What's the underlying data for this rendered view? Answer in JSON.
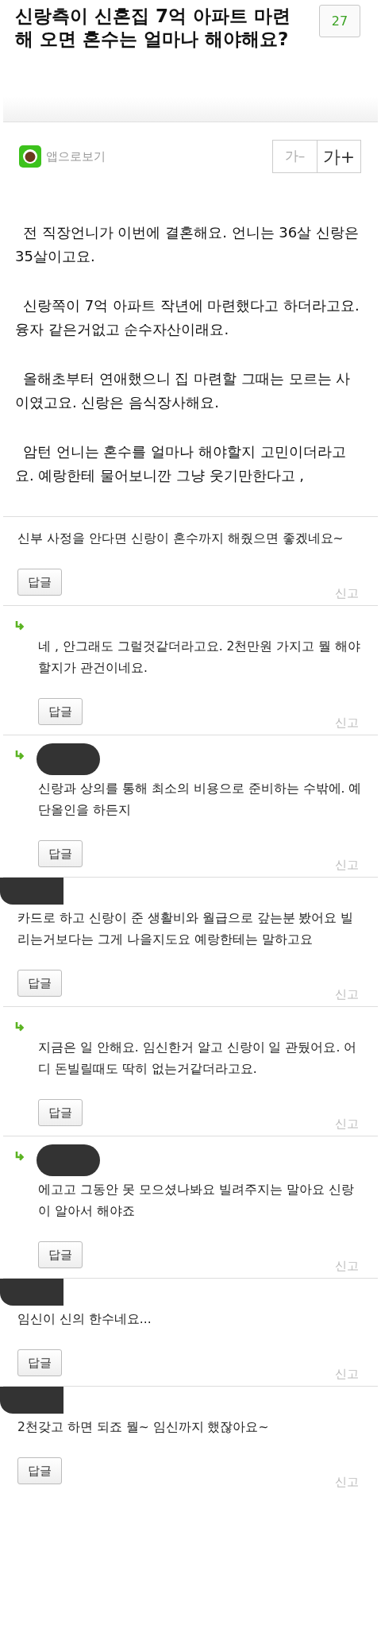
{
  "title": "신랑측이 신혼집 7억 아파트 마련해 오면 혼수는 얼마나 해야해요?",
  "comment_count": "27",
  "app_link": "앱으로보기",
  "font_buttons": [
    "가–",
    "가+"
  ],
  "body": [
    "전 직장언니가 이번에 결혼해요. 언니는 36살 신랑은 35살이고요.",
    "신랑쪽이 7억 아파트 작년에 마련했다고 하더라고요. 융자 같은거없고 순수자산이래요.",
    "올해초부터 연애했으니 집 마련할 그때는 모르는 사이였고요.  신랑은 음식장사해요.",
    "암턴 언니는 혼수를 얼마나 해야할지 고민이더라고요.  예랑한테 물어보니깐 그냥 웃기만한다고 ,"
  ],
  "comments": [
    {
      "kind": "comment",
      "redacted": false,
      "text": "신부 사정을 안다면 신랑이 혼수까지 해줬으면 좋겠네요~",
      "reply_button": "답글",
      "report": "신고"
    },
    {
      "kind": "reply",
      "redacted": false,
      "text": "네 , 안그래도 그럴것같더라고요. 2천만원 가지고 뭘 해야할지가 관건이네요.",
      "reply_button": "답글",
      "report": "신고"
    },
    {
      "kind": "reply",
      "redacted": true,
      "text": "신랑과 상의를 통해 최소의 비용으로 준비하는 수밖에. 예단올인을 하든지",
      "reply_button": "답글",
      "report": "신고"
    },
    {
      "kind": "comment",
      "redacted": true,
      "text": "카드로 하고 신랑이 준 생활비와 월급으로 갚는분 봤어요 빌리는거보다는 그게 나을지도요 예랑한테는 말하고요",
      "reply_button": "답글",
      "report": "신고"
    },
    {
      "kind": "reply",
      "redacted": false,
      "text": "지금은 일 안해요. 임신한거 알고 신랑이 일 관뒀어요. 어디 돈빌릴때도 딱히 없는거같더라고요.",
      "reply_button": "답글",
      "report": "신고"
    },
    {
      "kind": "reply",
      "redacted": true,
      "text": "에고고 그동안 못 모으셨나봐요 빌려주지는 말아요 신랑이 알아서 해야죠",
      "reply_button": "답글",
      "report": "신고"
    },
    {
      "kind": "comment",
      "redacted": true,
      "text": "임신이 신의 한수네요...",
      "reply_button": "답글",
      "report": "신고"
    },
    {
      "kind": "comment",
      "redacted": true,
      "text": "2천갖고 하면 되죠 뭘~ 임신까지 했잖아요~",
      "reply_button": "답글",
      "report": "신고"
    }
  ]
}
